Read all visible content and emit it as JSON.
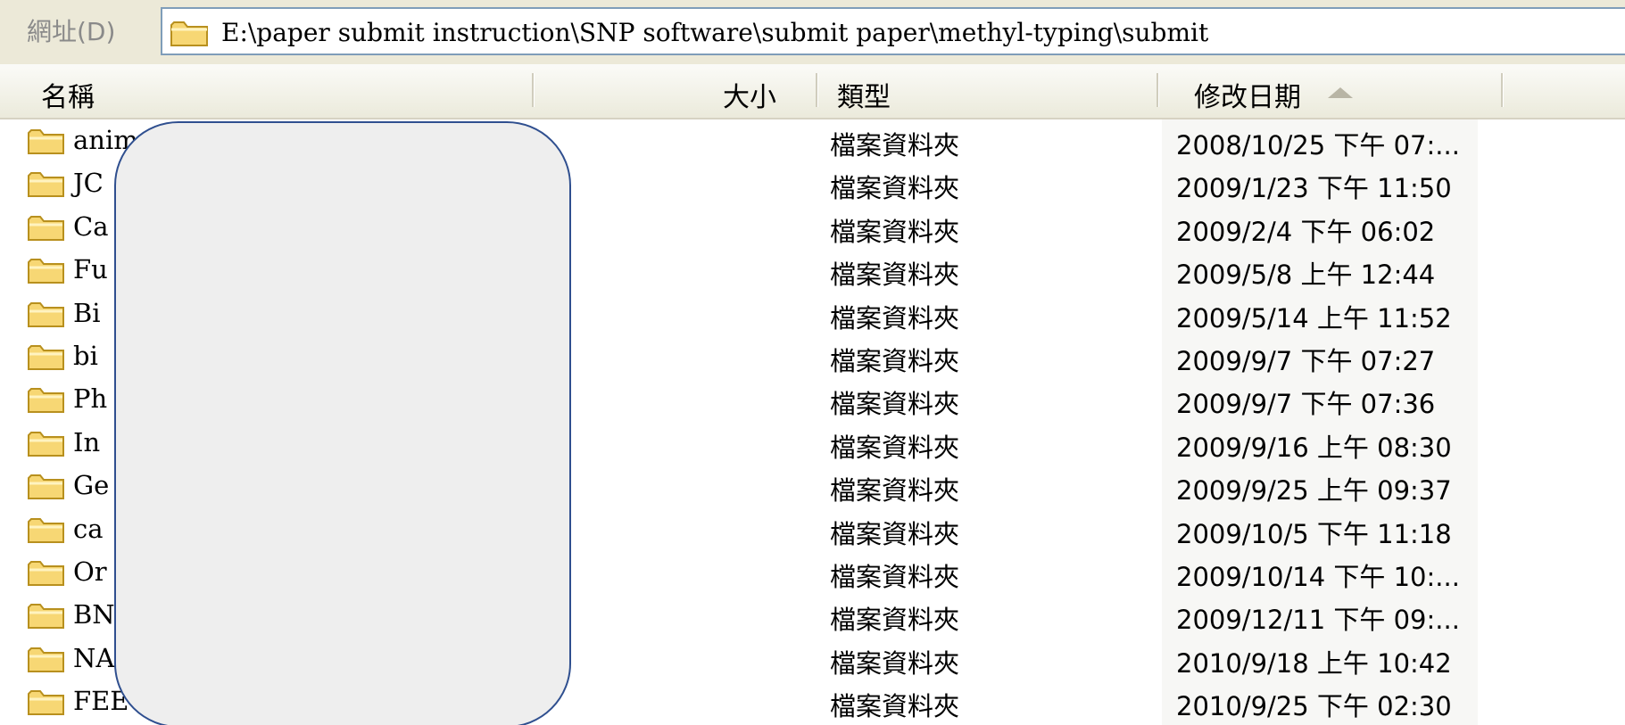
{
  "address_bar": {
    "label": "網址(D)",
    "path": "E:\\paper submit instruction\\SNP software\\submit paper\\methyl-typing\\submit",
    "icon": "folder-icon"
  },
  "columns": {
    "name": "名稱",
    "size": "大小",
    "type": "類型",
    "modified": "修改日期",
    "sort_indicator": "sort-ascending-icon"
  },
  "rows": [
    {
      "name": "anim",
      "type": "檔案資料夾",
      "modified": "2008/10/25 下午 07:..."
    },
    {
      "name": "JC",
      "type": "檔案資料夾",
      "modified": "2009/1/23 下午 11:50"
    },
    {
      "name": "Ca",
      "type": "檔案資料夾",
      "modified": "2009/2/4 下午 06:02"
    },
    {
      "name": "Fu",
      "type": "檔案資料夾",
      "modified": "2009/5/8 上午 12:44"
    },
    {
      "name": "Bi",
      "type": "檔案資料夾",
      "modified": "2009/5/14 上午 11:52"
    },
    {
      "name": "bi",
      "type": "檔案資料夾",
      "modified": "2009/9/7 下午 07:27"
    },
    {
      "name": "Ph",
      "type": "檔案資料夾",
      "modified": "2009/9/7 下午 07:36"
    },
    {
      "name": "In",
      "type": "檔案資料夾",
      "modified": "2009/9/16 上午 08:30"
    },
    {
      "name": "Ge",
      "type": "檔案資料夾",
      "modified": "2009/9/25 上午 09:37"
    },
    {
      "name": "ca",
      "type": "檔案資料夾",
      "modified": "2009/10/5 下午 11:18"
    },
    {
      "name": "Or",
      "type": "檔案資料夾",
      "modified": "2009/10/14 下午 10:..."
    },
    {
      "name": "BN",
      "type": "檔案資料夾",
      "modified": "2009/12/11 下午 09:..."
    },
    {
      "name": "NA",
      "type": "檔案資料夾",
      "modified": "2010/9/18 上午 10:42"
    },
    {
      "name": "FEE",
      "type": "檔案資料夾",
      "modified": "2010/9/25 下午 02:30"
    }
  ],
  "colors": {
    "folder_fill": "#f7d774",
    "folder_stroke": "#b8901e",
    "address_border": "#7f9db9",
    "redaction_fill": "#eeeeee",
    "redaction_border": "#2f4f8f"
  }
}
